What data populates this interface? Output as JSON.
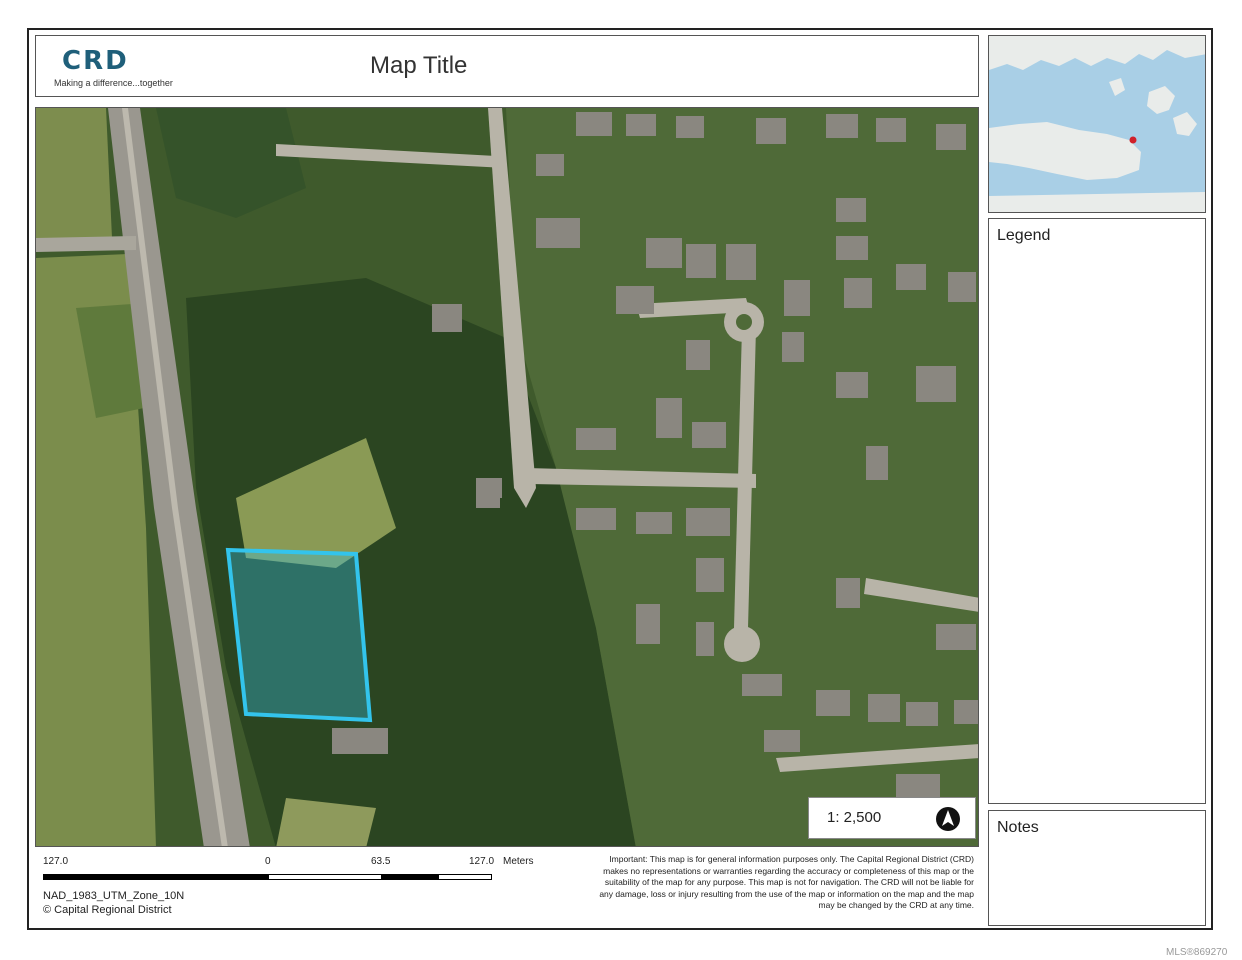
{
  "logo": {
    "mark": "CRD",
    "tagline": "Making a difference...together"
  },
  "title": "Map Title",
  "legend": {
    "title": "Legend"
  },
  "notes": {
    "title": "Notes"
  },
  "scale": {
    "ratio_text": "1: 2,500"
  },
  "scalebar": {
    "ticks": [
      "127.0",
      "0",
      "63.5",
      "127.0"
    ],
    "unit": "Meters"
  },
  "projection": "NAD_1983_UTM_Zone_10N",
  "copyright": "© Capital Regional District",
  "disclaimer": "Important: This map is for general information purposes only. The Capital Regional District (CRD) makes no representations or warranties regarding the accuracy or completeness of this map or the suitability of the map for any purpose. This map is not for navigation. The CRD will not be liable for any damage, loss or injury resulting from the use of the map or information on the map and the map may be changed by the CRD at any time.",
  "watermark": "MLS®869270",
  "colors": {
    "parcel_outline": "#33c4ec",
    "forest": "#2e4a22",
    "grass": "#8a9a55",
    "road": "#b8b4a8",
    "inset_water": "#a9cfe6",
    "inset_land": "#e9ecea",
    "inset_marker": "#d0202a"
  }
}
